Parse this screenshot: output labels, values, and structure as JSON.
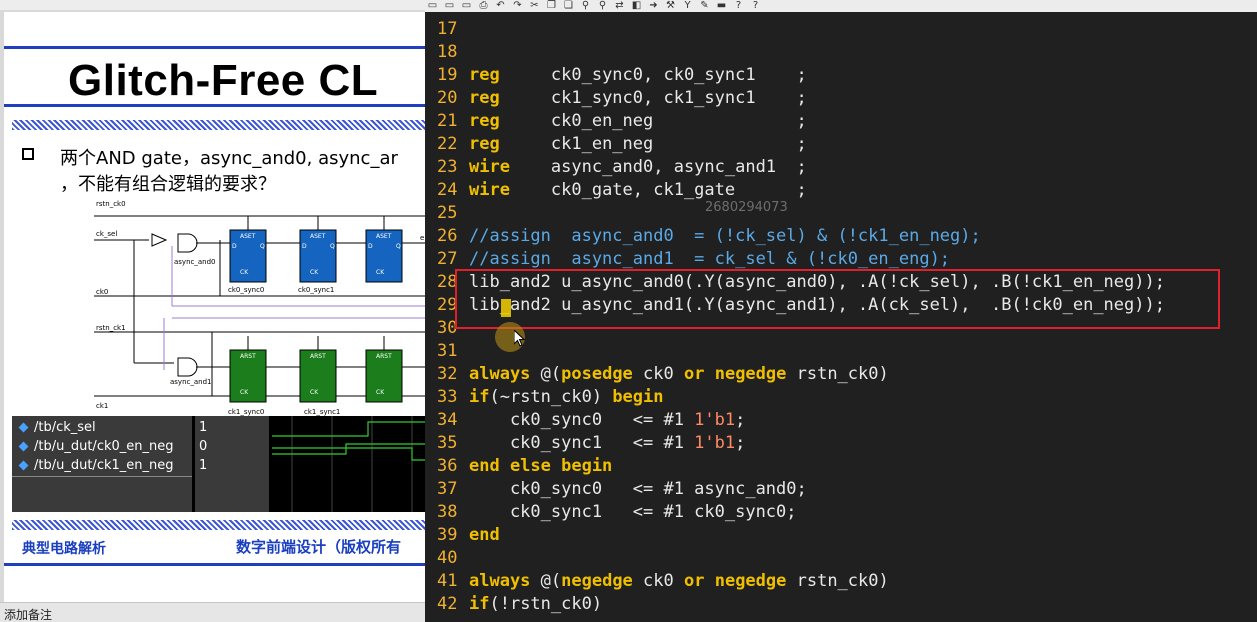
{
  "slide": {
    "title": "Glitch-Free CL",
    "bullet_line1": "两个AND gate，async_and0, async_ar",
    "bullet_line2": "，不能有组合逻辑的要求？",
    "footer_left": "典型电路解析",
    "footer_right": "数字前端设计（版权所有",
    "status_text": "添加备注",
    "circuit": {
      "rstn_ck0": "rstn_ck0",
      "ck_sel": "ck_sel",
      "ck0": "ck0",
      "rstn_ck1": "rstn_ck1",
      "ck1": "ck1",
      "async_and0": "async_and0",
      "async_and1": "async_and1",
      "ck0_sync0": "ck0_sync0",
      "ck0_sync1": "ck0_sync1",
      "ck1_sync0": "ck1_sync0",
      "ck1_sync1": "ck1_sync1",
      "aset": "ASET",
      "arst": "ARST",
      "d": "D",
      "q": "Q",
      "ck": "CK",
      "e_cut": "e"
    },
    "wave": {
      "signals": [
        "/tb/ck_sel",
        "/tb/u_dut/ck0_en_neg",
        "/tb/u_dut/ck1_en_neg"
      ],
      "values": [
        "1",
        "0",
        "1"
      ]
    },
    "colors": {
      "flop_top": "#1565c0",
      "flop_bottom": "#1b7d1b",
      "footer_text": "#1a3fbf",
      "wave_trace": "#33cc33"
    }
  },
  "editor": {
    "toolbar_icons": [
      "save-icon",
      "save-as-icon",
      "save-all-icon",
      "print-icon",
      "undo-icon",
      "redo-icon",
      "cut-icon",
      "copy-icon",
      "paste-icon",
      "find-icon",
      "find-next-icon",
      "replace-icon",
      "bookmark-icon",
      "goto-icon",
      "tool-icon",
      "filter-icon",
      "brush-icon",
      "highlight-icon",
      "help-icon",
      "pointer-help-icon"
    ],
    "watermark": "2680294073",
    "colors": {
      "background": "#202020",
      "keyword": "#f0c000",
      "comment": "#5aa9e6",
      "line_number": "#f0b030",
      "highlight_box": "#e0202a"
    },
    "lines": [
      {
        "n": "17",
        "tokens": []
      },
      {
        "n": "18",
        "tokens": []
      },
      {
        "n": "19",
        "tokens": [
          {
            "t": "reg",
            "c": "kw"
          },
          {
            "t": "     ck0_sync0, ck0_sync1    ;",
            "c": ""
          }
        ]
      },
      {
        "n": "20",
        "tokens": [
          {
            "t": "reg",
            "c": "kw"
          },
          {
            "t": "     ck1_sync0, ck1_sync1    ;",
            "c": ""
          }
        ]
      },
      {
        "n": "21",
        "tokens": [
          {
            "t": "reg",
            "c": "kw"
          },
          {
            "t": "     ck0_en_neg              ;",
            "c": ""
          }
        ]
      },
      {
        "n": "22",
        "tokens": [
          {
            "t": "reg",
            "c": "kw"
          },
          {
            "t": "     ck1_en_neg              ;",
            "c": ""
          }
        ]
      },
      {
        "n": "23",
        "tokens": [
          {
            "t": "wire",
            "c": "kw"
          },
          {
            "t": "    async_and0, async_and1  ;",
            "c": ""
          }
        ]
      },
      {
        "n": "24",
        "tokens": [
          {
            "t": "wire",
            "c": "kw"
          },
          {
            "t": "    ck0_gate, ck1_gate      ;",
            "c": ""
          }
        ]
      },
      {
        "n": "25",
        "tokens": []
      },
      {
        "n": "26",
        "tokens": [
          {
            "t": "//assign  async_and0  = (!ck_sel) & (!ck1_en_neg);",
            "c": "cm"
          }
        ]
      },
      {
        "n": "27",
        "tokens": [
          {
            "t": "//assign  async_and1  = ck_sel & (!ck0_en_eng);",
            "c": "cm"
          }
        ]
      },
      {
        "n": "28",
        "tokens": [
          {
            "t": "lib_and2 u_async_and0(.Y(async_and0), .A(!ck_sel), .B(!ck1_en_neg));",
            "c": ""
          }
        ]
      },
      {
        "n": "29",
        "tokens": [
          {
            "t": "lib_and2 u_async_and1(.Y(async_and1), .A(ck_sel),  .B(!ck0_en_neg));",
            "c": ""
          }
        ]
      },
      {
        "n": "30",
        "tokens": []
      },
      {
        "n": "31",
        "tokens": []
      },
      {
        "n": "32",
        "tokens": [
          {
            "t": "always",
            "c": "kw"
          },
          {
            "t": " @(",
            "c": ""
          },
          {
            "t": "posedge",
            "c": "kw"
          },
          {
            "t": " ck0 ",
            "c": ""
          },
          {
            "t": "or",
            "c": "kw"
          },
          {
            "t": " ",
            "c": ""
          },
          {
            "t": "negedge",
            "c": "kw"
          },
          {
            "t": " rstn_ck0)",
            "c": ""
          }
        ]
      },
      {
        "n": "33",
        "tokens": [
          {
            "t": "if",
            "c": "kw"
          },
          {
            "t": "(~rstn_ck0) ",
            "c": ""
          },
          {
            "t": "begin",
            "c": "kw"
          }
        ]
      },
      {
        "n": "34",
        "tokens": [
          {
            "t": "    ck0_sync0   <= #1 ",
            "c": ""
          },
          {
            "t": "1'b1",
            "c": "num"
          },
          {
            "t": ";",
            "c": ""
          }
        ]
      },
      {
        "n": "35",
        "tokens": [
          {
            "t": "    ck0_sync1   <= #1 ",
            "c": ""
          },
          {
            "t": "1'b1",
            "c": "num"
          },
          {
            "t": ";",
            "c": ""
          }
        ]
      },
      {
        "n": "36",
        "tokens": [
          {
            "t": "end else begin",
            "c": "kw"
          }
        ]
      },
      {
        "n": "37",
        "tokens": [
          {
            "t": "    ck0_sync0   <= #1 async_and0;",
            "c": ""
          }
        ]
      },
      {
        "n": "38",
        "tokens": [
          {
            "t": "    ck0_sync1   <= #1 ck0_sync0;",
            "c": ""
          }
        ]
      },
      {
        "n": "39",
        "tokens": [
          {
            "t": "end",
            "c": "kw"
          }
        ]
      },
      {
        "n": "40",
        "tokens": []
      },
      {
        "n": "41",
        "tokens": [
          {
            "t": "always",
            "c": "kw"
          },
          {
            "t": " @(",
            "c": ""
          },
          {
            "t": "negedge",
            "c": "kw"
          },
          {
            "t": " ck0 ",
            "c": ""
          },
          {
            "t": "or",
            "c": "kw"
          },
          {
            "t": " ",
            "c": ""
          },
          {
            "t": "negedge",
            "c": "kw"
          },
          {
            "t": " rstn_ck0)",
            "c": ""
          }
        ]
      },
      {
        "n": "42",
        "tokens": [
          {
            "t": "if",
            "c": "kw"
          },
          {
            "t": "(!rstn_ck0)",
            "c": ""
          }
        ]
      }
    ]
  }
}
